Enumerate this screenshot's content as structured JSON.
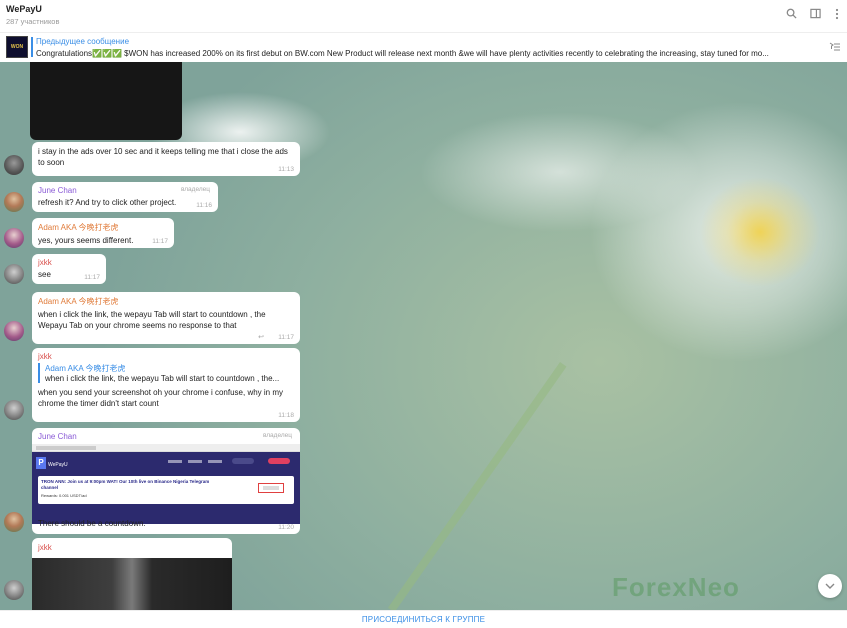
{
  "header": {
    "title": "WePayU",
    "subtitle": "287 участников",
    "icons": [
      "search-icon",
      "sidebar-toggle-icon",
      "more-options-icon"
    ]
  },
  "pinned": {
    "label": "Предыдущее сообщение",
    "thumb_text": "WON",
    "text": "Congratulations✅✅✅ $WON has increased 200% on its first debut on BW.com   New Product will release next month &we will have plenty activities recently to celebrating the increasing, stay tuned for mo..."
  },
  "messages": [
    {
      "sender": "",
      "text": "i stay in the ads over 10 sec and it keeps telling me that i close the ads to soon",
      "time": "11:13"
    },
    {
      "sender": "June Chan",
      "role": "владелец",
      "text": "refresh it? And try to click other project.",
      "time": "11:16"
    },
    {
      "sender": "Adam AKA 今晚打老虎",
      "text": "yes, yours seems different.",
      "time": "11:17"
    },
    {
      "sender": "jxkk",
      "text": "see",
      "time": "11:17"
    },
    {
      "sender": "Adam AKA 今晚打老虎",
      "text": "when i click the link, the wepayu Tab will start to countdown , the Wepayu Tab on your chrome seems no response to that",
      "time": "11:17"
    },
    {
      "sender": "jxkk",
      "reply_name": "Adam AKA 今晚打老虎",
      "reply_text": "when i click the link, the wepayu Tab will start to countdown , the...",
      "text": "when you send your screenshot oh your chrome i confuse, why in my chrome the timer didn't start count",
      "time": "11:18"
    },
    {
      "sender": "June Chan",
      "role": "владелец",
      "text": "There should be a countdown.",
      "time": "11:20"
    },
    {
      "sender": "jxkk",
      "text": "",
      "time": ""
    }
  ],
  "screenshot": {
    "brand": "WePayU",
    "card_line1": "TRON ANN: Join us at 9:00pm WAT! Our 10th live on Binance Nigeria Telegram",
    "card_line2": "channel",
    "card_line3": "Rewards: 0.001 USDT/ad"
  },
  "bottom": {
    "join_label": "ПРИСОЕДИНИТЬСЯ К ГРУППЕ"
  },
  "watermark": "ForexNeo",
  "colors": {
    "accent": "#3a8ee6",
    "june": "#8a5bd6",
    "adam": "#e07b3a",
    "jxkk": "#d9534f"
  }
}
